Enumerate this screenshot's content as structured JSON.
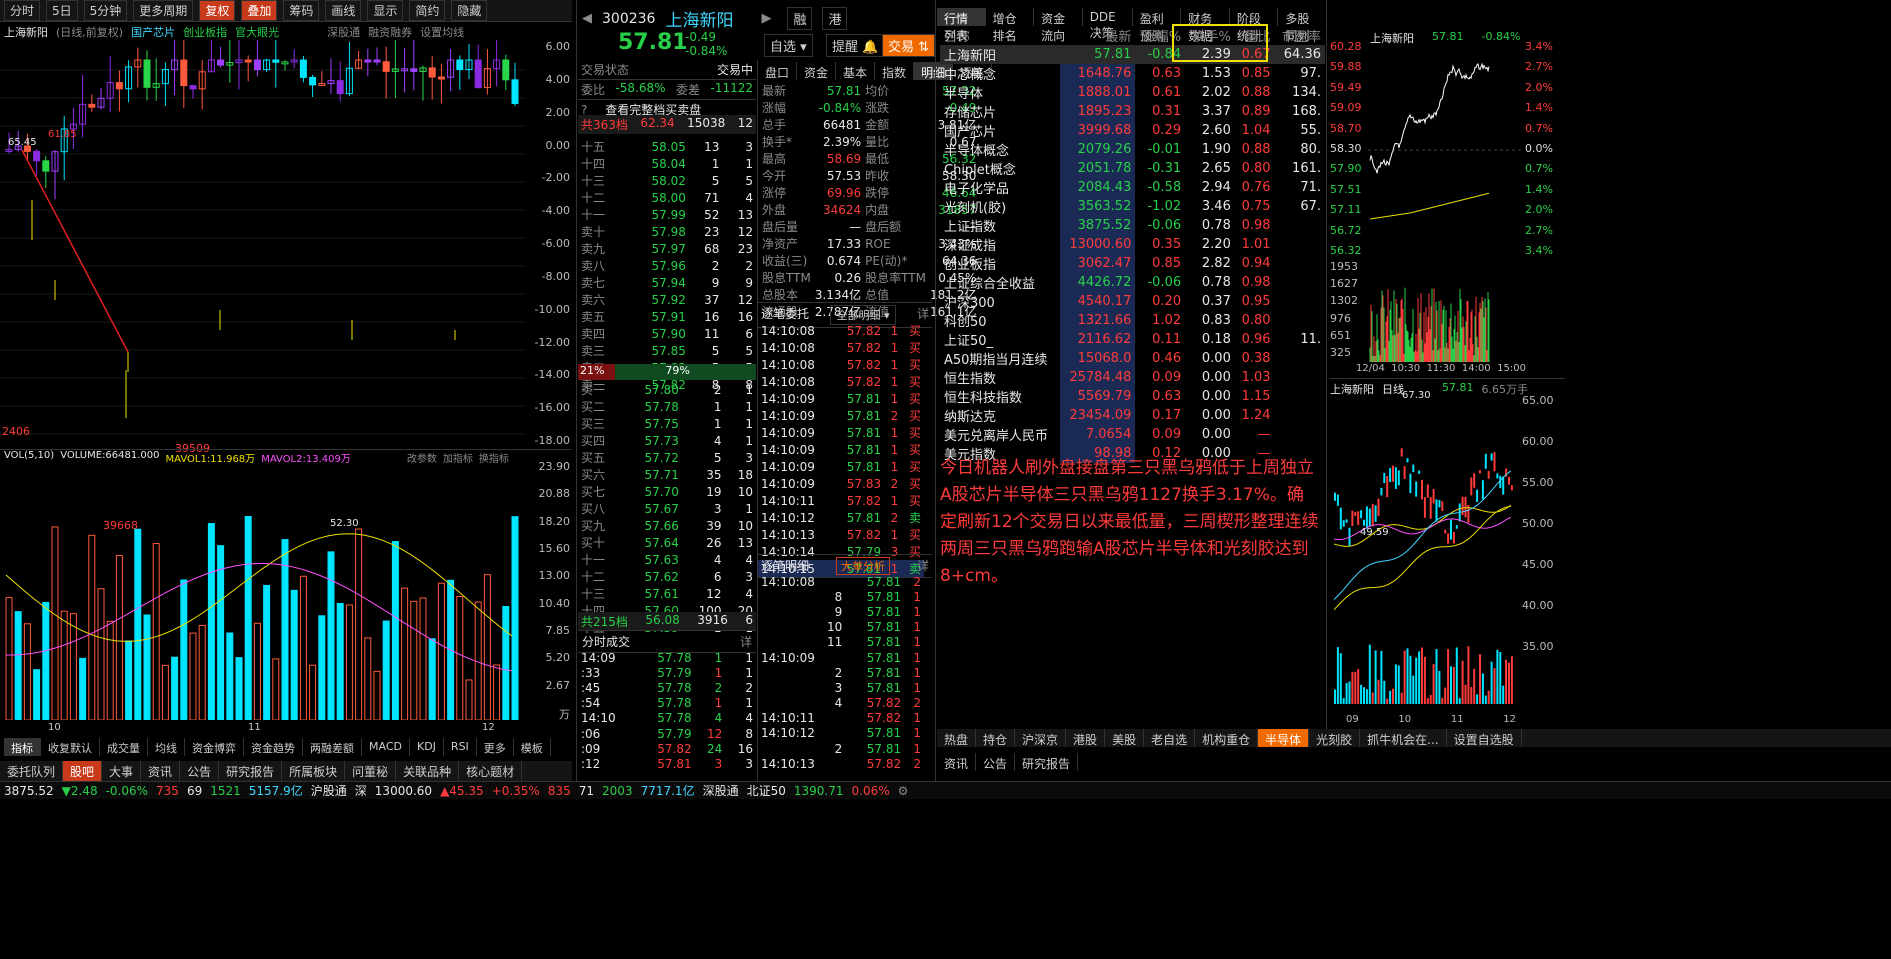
{
  "left_toolbar": [
    "分时",
    "5日",
    "5分钟",
    "更多周期",
    "复权",
    "叠加",
    "筹码",
    "画线",
    "显示",
    "简约",
    "隐藏"
  ],
  "chart_legend": {
    "stock": "上海新阳",
    "mode": "(日线,前复权)",
    "overlays": [
      "国产芯片",
      "创业板指",
      "官大眼光"
    ],
    "links": [
      "深股通",
      "融资融券",
      "设置均线"
    ]
  },
  "kline_labels": {
    "high": "65.45",
    "high2": "61.85",
    "low": "52.30",
    "v1": "2406",
    "v2": "39509",
    "v3": "39668"
  },
  "kline_axis": [
    "6.00",
    "4.00",
    "2.00",
    "0.00",
    "-2.00",
    "-4.00",
    "-6.00",
    "-8.00",
    "-10.00",
    "-12.00",
    "-14.00",
    "-16.00",
    "-18.00"
  ],
  "vol_legend": {
    "name": "VOL(5,10)",
    "volume": "VOLUME:66481.000",
    "ma1": "MAVOL1:11.968万",
    "ma2": "MAVOL2:13.409万",
    "links": [
      "改参数",
      "加指标",
      "换指标"
    ]
  },
  "vol_axis": [
    "23.90",
    "20.88",
    "18.20",
    "15.60",
    "13.00",
    "10.40",
    "7.85",
    "5.20",
    "2.67",
    "万"
  ],
  "date_labels": [
    "10",
    "11",
    "12"
  ],
  "indicator_tabs": [
    "指标",
    "收复默认",
    "成交量",
    "均线",
    "资金博弈",
    "资金趋势",
    "两融差额",
    "MACD",
    "KDJ",
    "RSI",
    "更多",
    "模板"
  ],
  "bottom_tabs": [
    "委托队列",
    "股吧",
    "大事",
    "资讯",
    "公告",
    "研究报告",
    "所属板块",
    "问董秘",
    "关联品种",
    "核心题材"
  ],
  "quote": {
    "code": "300236",
    "name": "上海新阳",
    "price": "57.81",
    "change": "-0.49",
    "pct": "-0.84%",
    "tags": [
      "融",
      "港"
    ],
    "btns": [
      "自选",
      "提醒",
      "交易"
    ]
  },
  "trade_status": {
    "label": "交易状态",
    "value": "交易中",
    "ratio_label": "委比",
    "ratio": "-58.68%",
    "diff_label": "委差",
    "diff": "-11122",
    "view": "查看完整档买卖盘"
  },
  "ask_total": {
    "label": "共363档",
    "price": "62.34",
    "vol": "15038",
    "n": "12"
  },
  "asks": [
    [
      "十五",
      "58.05",
      "13",
      "3"
    ],
    [
      "十四",
      "58.04",
      "1",
      "1"
    ],
    [
      "十三",
      "58.02",
      "5",
      "5"
    ],
    [
      "十二",
      "58.00",
      "71",
      "4"
    ],
    [
      "十一",
      "57.99",
      "52",
      "13"
    ],
    [
      "卖十",
      "57.98",
      "23",
      "12"
    ],
    [
      "卖九",
      "57.97",
      "68",
      "23"
    ],
    [
      "卖八",
      "57.96",
      "2",
      "2"
    ],
    [
      "卖七",
      "57.94",
      "9",
      "9"
    ],
    [
      "卖六",
      "57.92",
      "37",
      "12"
    ],
    [
      "卖五",
      "57.91",
      "16",
      "16"
    ],
    [
      "卖四",
      "57.90",
      "11",
      "6"
    ],
    [
      "卖三",
      "57.85",
      "5",
      "5"
    ],
    [
      "卖二",
      "57.83",
      "5",
      "5"
    ],
    [
      "卖一",
      "57.82",
      "8",
      "8"
    ]
  ],
  "split": {
    "left": "21%",
    "right": "79%"
  },
  "bids": [
    [
      "买一",
      "57.80",
      "2",
      "1"
    ],
    [
      "买二",
      "57.78",
      "1",
      "1"
    ],
    [
      "买三",
      "57.75",
      "1",
      "1"
    ],
    [
      "买四",
      "57.73",
      "4",
      "1"
    ],
    [
      "买五",
      "57.72",
      "5",
      "3"
    ],
    [
      "买六",
      "57.71",
      "35",
      "18"
    ],
    [
      "买七",
      "57.70",
      "19",
      "10"
    ],
    [
      "买八",
      "57.67",
      "3",
      "1"
    ],
    [
      "买九",
      "57.66",
      "39",
      "10"
    ],
    [
      "买十",
      "57.64",
      "26",
      "13"
    ],
    [
      "十一",
      "57.63",
      "4",
      "4"
    ],
    [
      "十二",
      "57.62",
      "6",
      "3"
    ],
    [
      "十三",
      "57.61",
      "12",
      "4"
    ],
    [
      "十四",
      "57.60",
      "100",
      "20"
    ],
    [
      "十五",
      "57.59",
      "1",
      "1"
    ]
  ],
  "bid_total": {
    "label": "共215档",
    "price": "56.08",
    "vol": "3916",
    "n": "6"
  },
  "fenshi_title": "分时成交",
  "fenshi": [
    [
      "14:09",
      "57.78",
      "1",
      "1"
    ],
    [
      ":33",
      "57.79",
      "1",
      "1"
    ],
    [
      ":45",
      "57.78",
      "2",
      "2"
    ],
    [
      ":54",
      "57.78",
      "1",
      "1"
    ],
    [
      "14:10",
      "57.78",
      "4",
      "4"
    ],
    [
      ":06",
      "57.79",
      "12",
      "8"
    ],
    [
      ":09",
      "57.82",
      "24",
      "16"
    ],
    [
      ":12",
      "57.81",
      "3",
      "3"
    ]
  ],
  "info_tabs": [
    "盘口",
    "资金",
    "基本",
    "指数",
    "明细",
    "逐笔"
  ],
  "info": [
    [
      "最新",
      "57.81",
      "均价",
      "57.32"
    ],
    [
      "涨幅",
      "-0.84%",
      "涨跌",
      "-0.49"
    ],
    [
      "总手",
      "66481",
      "金额",
      "3.81亿"
    ],
    [
      "换手*",
      "2.39%",
      "量比",
      "0.67"
    ],
    [
      "最高",
      "58.69",
      "最低",
      "56.32"
    ],
    [
      "今开",
      "57.53",
      "昨收",
      "58.30"
    ],
    [
      "涨停",
      "69.96",
      "跌停",
      "46.64"
    ],
    [
      "外盘",
      "34624",
      "内盘",
      "31857"
    ],
    [
      "盘后量",
      "—",
      "盘后额",
      "—"
    ],
    [
      "净资产",
      "17.33",
      "ROE",
      "3.43%"
    ],
    [
      "收益(三)",
      "0.674",
      "PE(动)*",
      "64.36"
    ],
    [
      "股息TTM",
      "0.26",
      "股息率TTM",
      "0.45%"
    ],
    [
      "总股本",
      "3.134亿",
      "总值",
      "181.2亿"
    ],
    [
      "流通股",
      "2.787亿",
      "流值",
      "161.1亿"
    ]
  ],
  "zhubi_title": "逐笔委托",
  "zhubi_filter": "全部明细",
  "zhubi": [
    [
      "14:10:08",
      "57.82",
      "1",
      "买"
    ],
    [
      "14:10:08",
      "57.82",
      "1",
      "买"
    ],
    [
      "14:10:08",
      "57.82",
      "1",
      "买"
    ],
    [
      "14:10:08",
      "57.82",
      "1",
      "买"
    ],
    [
      "14:10:09",
      "57.81",
      "1",
      "买"
    ],
    [
      "14:10:09",
      "57.81",
      "2",
      "买"
    ],
    [
      "14:10:09",
      "57.81",
      "1",
      "买"
    ],
    [
      "14:10:09",
      "57.81",
      "1",
      "买"
    ],
    [
      "14:10:09",
      "57.81",
      "1",
      "买"
    ],
    [
      "14:10:09",
      "57.83",
      "2",
      "买"
    ],
    [
      "14:10:11",
      "57.82",
      "1",
      "买"
    ],
    [
      "14:10:12",
      "57.81",
      "2",
      "卖"
    ],
    [
      "14:10:13",
      "57.82",
      "1",
      "买"
    ],
    [
      "14:10:14",
      "57.79",
      "3",
      "买"
    ],
    [
      "14:10:15",
      "57.81",
      "1",
      "卖"
    ]
  ],
  "mingxi_title": "逐笔明细",
  "mingxi_btn": "大单分析",
  "mingxi": [
    [
      "14:10:08",
      "57.81",
      "2"
    ],
    [
      "8",
      "57.81",
      "1"
    ],
    [
      "9",
      "57.81",
      "1"
    ],
    [
      "10",
      "57.81",
      "1"
    ],
    [
      "11",
      "57.81",
      "1"
    ],
    [
      "14:10:09",
      "57.81",
      "1"
    ],
    [
      "2",
      "57.81",
      "1"
    ],
    [
      "3",
      "57.81",
      "1"
    ],
    [
      "4",
      "57.82",
      "2"
    ],
    [
      "14:10:11",
      "57.82",
      "1"
    ],
    [
      "14:10:12",
      "57.81",
      "1"
    ],
    [
      "2",
      "57.81",
      "1"
    ],
    [
      "14:10:13",
      "57.82",
      "2"
    ]
  ],
  "market_tabs": [
    "行情列表",
    "增仓排名",
    "资金流向",
    "DDE决策",
    "盈利预测",
    "财务数据",
    "阶段统计",
    "多股同列"
  ],
  "market_header": [
    "名称",
    "最新",
    "涨幅%",
    "换手%",
    "量比",
    "市盈率"
  ],
  "market_rows": [
    [
      "上海新阳",
      "57.81",
      "-0.84",
      "2.39",
      "0.67",
      "64.36"
    ],
    [
      "中芯概念",
      "1648.76",
      "0.63",
      "1.53",
      "0.85",
      "97."
    ],
    [
      "半导体",
      "1888.01",
      "0.61",
      "2.02",
      "0.88",
      "134."
    ],
    [
      "存储芯片",
      "1895.23",
      "0.31",
      "3.37",
      "0.89",
      "168."
    ],
    [
      "国产芯片",
      "3999.68",
      "0.29",
      "2.60",
      "1.04",
      "55."
    ],
    [
      "半导体概念",
      "2079.26",
      "-0.01",
      "1.90",
      "0.88",
      "80."
    ],
    [
      "Chiplet概念",
      "2051.78",
      "-0.31",
      "2.65",
      "0.80",
      "161."
    ],
    [
      "电子化学品",
      "2084.43",
      "-0.58",
      "2.94",
      "0.76",
      "71."
    ],
    [
      "光刻机(胶)",
      "3563.52",
      "-1.02",
      "3.46",
      "0.75",
      "67."
    ],
    [
      "上证指数",
      "3875.52",
      "-0.06",
      "0.78",
      "0.98",
      ""
    ],
    [
      "深证成指",
      "13000.60",
      "0.35",
      "2.20",
      "1.01",
      ""
    ],
    [
      "创业板指",
      "3062.47",
      "0.85",
      "2.82",
      "0.94",
      ""
    ],
    [
      "上证综合全收益",
      "4426.72",
      "-0.06",
      "0.78",
      "0.98",
      ""
    ],
    [
      "沪深300",
      "4540.17",
      "0.20",
      "0.37",
      "0.95",
      ""
    ],
    [
      "科创50",
      "1321.66",
      "1.02",
      "0.83",
      "0.80",
      ""
    ],
    [
      "上证50_",
      "2116.62",
      "0.11",
      "0.18",
      "0.96",
      "11."
    ],
    [
      "A50期指当月连续",
      "15068.0",
      "0.46",
      "0.00",
      "0.38",
      ""
    ],
    [
      "恒生指数",
      "25784.48",
      "0.09",
      "0.00",
      "1.03",
      ""
    ],
    [
      "恒生科技指数",
      "5569.79",
      "0.63",
      "0.00",
      "1.15",
      ""
    ],
    [
      "纳斯达克",
      "23454.09",
      "0.17",
      "0.00",
      "1.24",
      ""
    ],
    [
      "美元兑离岸人民币",
      "7.0654",
      "0.09",
      "0.00",
      "—",
      ""
    ],
    [
      "美元指数",
      "98.98",
      "0.12",
      "0.00",
      "—",
      ""
    ]
  ],
  "note": "今日机器人刷外盘接盘第三只黑乌鸦低于上周独立A股芯片半导体三只黑乌鸦1127换手3.17%。确定刷新12个交易日以来最低量，三周楔形整理连续两周三只黑乌鸦跑输A股芯片半导体和光刻胶达到8+cm。",
  "mini": {
    "name": "上海新阳",
    "price": "57.81",
    "pct": "-0.84%",
    "left_axis": [
      "60.28",
      "59.88",
      "59.49",
      "59.09",
      "58.70",
      "58.30",
      "57.90",
      "57.51",
      "57.11",
      "56.72",
      "56.32"
    ],
    "right_axis": [
      "3.4%",
      "2.7%",
      "2.0%",
      "1.4%",
      "0.7%",
      "0.0%",
      "0.7%",
      "1.4%",
      "2.0%",
      "2.7%",
      "3.4%"
    ],
    "vol_axis": [
      "1953",
      "1627",
      "1302",
      "976",
      "651",
      "325"
    ],
    "times": [
      "12/04",
      "10:30",
      "11:30",
      "14:00",
      "15:00"
    ]
  },
  "daily": {
    "name": "上海新阳",
    "mode": "日线",
    "price": "57.81",
    "vol": "6.65万手",
    "hi": "67.30",
    "lo": "49.59",
    "axis": [
      "65.00",
      "60.00",
      "55.00",
      "50.00",
      "45.00",
      "40.00",
      "35.00"
    ],
    "dates": [
      "09",
      "10",
      "11",
      "12"
    ]
  },
  "sector_tabs": [
    "热盘",
    "持仓",
    "沪深京",
    "港股",
    "美股",
    "老自选",
    "机构重仓",
    "半导体",
    "光刻胶",
    "抓牛机会在...",
    "设置自选股"
  ],
  "news_tabs": [
    "资讯",
    "公告",
    "研究报告"
  ],
  "status": {
    "sh_price": "3875.52",
    "sh_chg": "2.48",
    "sh_pct": "-0.06%",
    "sh_a": "735",
    "sh_b": "69",
    "sh_c": "1521",
    "sh_amt": "5157.9亿",
    "hgt": "沪股通",
    "sz_label": "深",
    "sz_price": "13000.60",
    "sz_chg": "45.35",
    "sz_pct": "+0.35%",
    "sz_a": "835",
    "sz_b": "71",
    "sz_c": "2003",
    "sz_amt": "7717.1亿",
    "sgt": "深股通",
    "bz": "北证50",
    "bz_price": "1390.71",
    "bz_pct": "0.06%"
  }
}
